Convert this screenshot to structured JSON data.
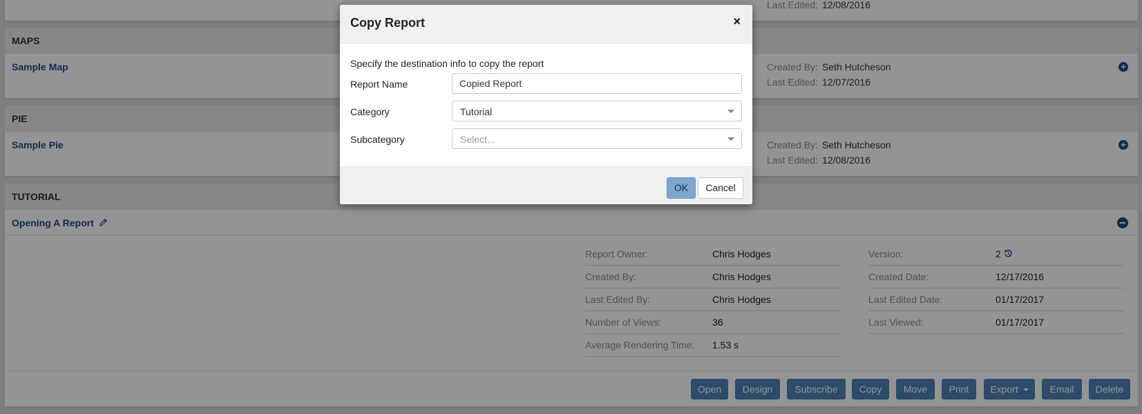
{
  "top_card": {
    "last_edited_label": "Last Edited:",
    "last_edited": "12/08/2016"
  },
  "sections": [
    {
      "header": "MAPS",
      "item": "Sample Map",
      "created_by_label": "Created By:",
      "created_by": "Seth Hutcheson",
      "last_edited_label": "Last Edited:",
      "last_edited": "12/07/2016"
    },
    {
      "header": "PIE",
      "item": "Sample Pie",
      "created_by_label": "Created By:",
      "created_by": "Seth Hutcheson",
      "last_edited_label": "Last Edited:",
      "last_edited": "12/08/2016"
    }
  ],
  "tutorial": {
    "header": "TUTORIAL",
    "item": "Opening A Report",
    "details_left": [
      {
        "label": "Report Owner:",
        "value": "Chris Hodges"
      },
      {
        "label": "Created By:",
        "value": "Chris Hodges"
      },
      {
        "label": "Last Edited By:",
        "value": "Chris Hodges"
      },
      {
        "label": "Number of Views:",
        "value": "36"
      },
      {
        "label": "Average Rendering Time:",
        "value": "1.53 s"
      }
    ],
    "details_right": [
      {
        "label": "Version:",
        "value": "2"
      },
      {
        "label": "Created Date:",
        "value": "12/17/2016"
      },
      {
        "label": "Last Edited Date:",
        "value": "01/17/2017"
      },
      {
        "label": "Last Viewed:",
        "value": "01/17/2017"
      }
    ],
    "actions": [
      "Open",
      "Design",
      "Subscribe",
      "Copy",
      "Move",
      "Print",
      "Export",
      "Email",
      "Delete"
    ]
  },
  "modal": {
    "title": "Copy Report",
    "close": "×",
    "instruction": "Specify the destination info to copy the report",
    "report_name_label": "Report Name",
    "report_name_value": "Copied Report",
    "category_label": "Category",
    "category_value": "Tutorial",
    "subcategory_label": "Subcategory",
    "subcategory_placeholder": "Select...",
    "ok": "OK",
    "cancel": "Cancel"
  },
  "colors": {
    "link": "#1b4e8a",
    "action_button": "#4f82b7",
    "ok_button": "#7fa6cf"
  }
}
